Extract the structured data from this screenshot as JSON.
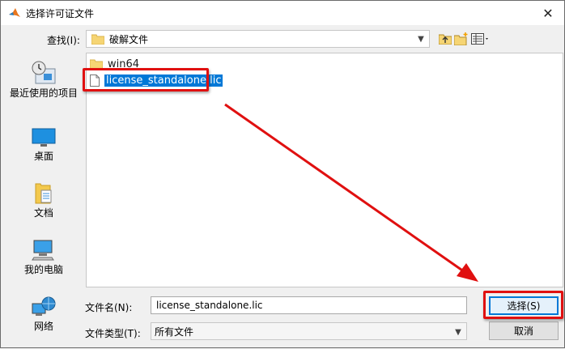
{
  "window": {
    "title": "选择许可证文件",
    "close_glyph": "✕"
  },
  "lookin": {
    "label": "查找(I):",
    "value": "破解文件"
  },
  "places": [
    {
      "label": "最近使用的项目",
      "icon": "recent-items-icon"
    },
    {
      "label": "桌面",
      "icon": "desktop-icon"
    },
    {
      "label": "文档",
      "icon": "documents-icon"
    },
    {
      "label": "我的电脑",
      "icon": "computer-icon"
    },
    {
      "label": "网络",
      "icon": "network-icon"
    }
  ],
  "files": [
    {
      "name": "win64",
      "type": "folder"
    },
    {
      "name": "license_standalone.lic",
      "type": "file",
      "selected": true
    }
  ],
  "filename": {
    "label": "文件名(N):",
    "value": "license_standalone.lic"
  },
  "filetype": {
    "label": "文件类型(T):",
    "value": "所有文件"
  },
  "buttons": {
    "select": "选择(S)",
    "cancel": "取消"
  },
  "colors": {
    "annotation_red": "#e01010",
    "selection_blue": "#0078d7"
  }
}
